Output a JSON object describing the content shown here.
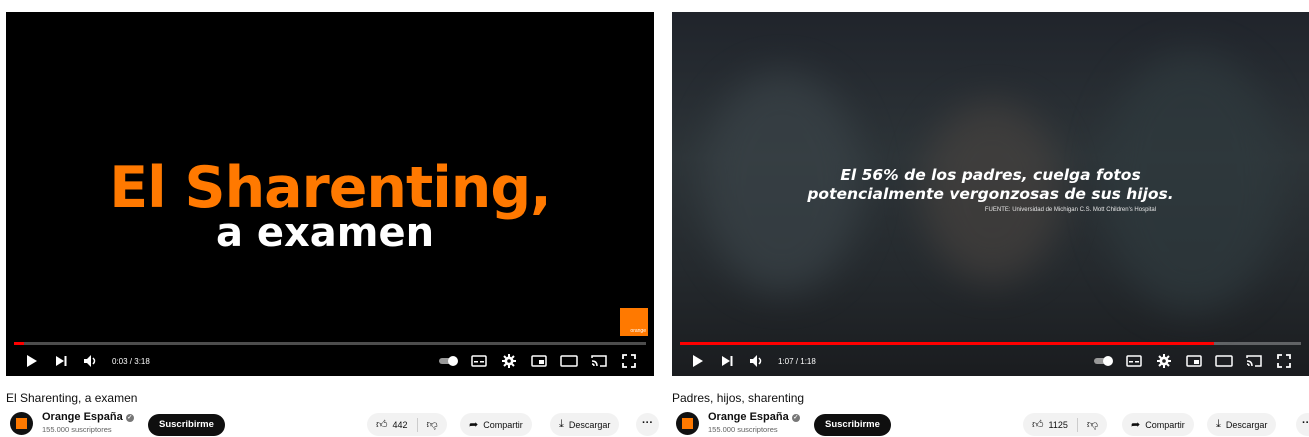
{
  "left": {
    "overlay_line1": "El Sharenting,",
    "overlay_line2": "a examen",
    "logo_text": "orange",
    "time": "0:03 / 3:18",
    "progress": 0.016,
    "video_title": "El Sharenting, a examen",
    "channel_name": "Orange España",
    "subscribers": "155.000 suscriptores",
    "subscribe_label": "Suscribirme",
    "likes": "442",
    "share_label": "Compartir",
    "download_label": "Descargar",
    "more_label": "···"
  },
  "right": {
    "stat_line1": "El 56% de los padres, cuelga fotos",
    "stat_line2": "potencialmente vergonzosas de sus hijos.",
    "source": "FUENTE: Universidad de Michigan C.S. Mott Children's Hospital",
    "time": "1:07 / 1:18",
    "progress": 0.86,
    "video_title": "Padres, hijos, sharenting",
    "channel_name": "Orange España",
    "subscribers": "155.000 suscriptores",
    "subscribe_label": "Suscribirme",
    "likes": "1125",
    "share_label": "Compartir",
    "download_label": "Descargar",
    "more_label": "···"
  },
  "icons": [
    "play-icon",
    "next-icon",
    "volume-icon",
    "autoplay-toggle-icon",
    "captions-icon",
    "settings-icon",
    "miniplayer-icon",
    "theater-icon",
    "cast-icon",
    "fullscreen-icon",
    "thumbs-up-icon",
    "thumbs-down-icon",
    "share-icon",
    "download-icon",
    "verified-icon"
  ],
  "colors": {
    "brand_orange": "#ff7900",
    "progress_red": "#ff0000",
    "button_dark": "#0f0f0f",
    "pill_bg": "#f2f2f2"
  }
}
